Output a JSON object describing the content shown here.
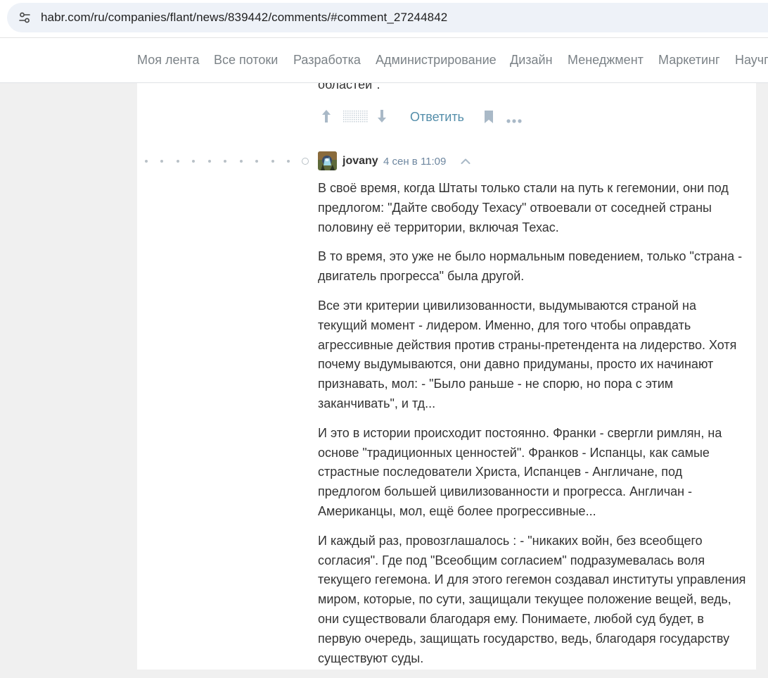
{
  "browser": {
    "url": "habr.com/ru/companies/flant/news/839442/comments/#comment_27244842",
    "site_settings_icon": "tune-icon"
  },
  "nav": {
    "items": [
      "Моя лента",
      "Все потоки",
      "Разработка",
      "Администрирование",
      "Дизайн",
      "Менеджмент",
      "Маркетинг",
      "Научп"
    ]
  },
  "previous_comment": {
    "tail_text": "областей\".",
    "actions": {
      "upvote_icon": "arrow-up-icon",
      "score_icon": "score-placeholder-icon",
      "downvote_icon": "arrow-down-icon",
      "reply_label": "Ответить",
      "bookmark_icon": "bookmark-icon",
      "more_icon": "more-dots-icon"
    }
  },
  "comment": {
    "username": "jovany",
    "time": "4 сен в 11:09",
    "collapse_icon": "chevron-up-icon",
    "paragraphs": [
      "В своё время, когда Штаты только стали на путь к гегемонии, они под предлогом: \"Дайте свободу Техасу\" отвоевали от соседней страны половину её территории, включая Техас.",
      "В то время, это уже не было нормальным поведением, только \"страна - двигатель прогресса\" была другой.",
      "Все эти критерии цивилизованности, выдумываются страной на текущий момент - лидером. Именно, для того чтобы оправдать агрессивные действия против страны-претендента на лидерство. Хотя почему выдумываются, они давно придуманы, просто их начинают признавать, мол: - \"Было раньше - не спорю, но пора с этим заканчивать\", и тд...",
      "И это в истории происходит постоянно. Франки - свергли римлян, на основе \"традиционных ценностей\". Франков - Испанцы, как самые страстные последователи Христа, Испанцев - Англичане, под предлогом большей цивилизованности и прогресса. Англичан - Американцы, мол, ещё более прогрессивные...",
      "И каждый раз, провозглашалось : - \"никаких войн, без всеобщего согласия\". Где под \"Всеобщим согласием\" подразумевалась воля текущего гегемона. И для этого гегемон создавал институты управления миром, которые, по сути, защищали текущее положение вещей, ведь, они существовали благодаря ему. Понимаете, любой суд будет, в первую очередь, защищать государство, ведь, благодаря государству существуют суды."
    ]
  },
  "colors": {
    "link": "#548eaa",
    "nav_text": "#7b8287",
    "time": "#6e87a0",
    "page_bg": "#f0f0f0",
    "icon_gray": "#a9b9c7"
  }
}
